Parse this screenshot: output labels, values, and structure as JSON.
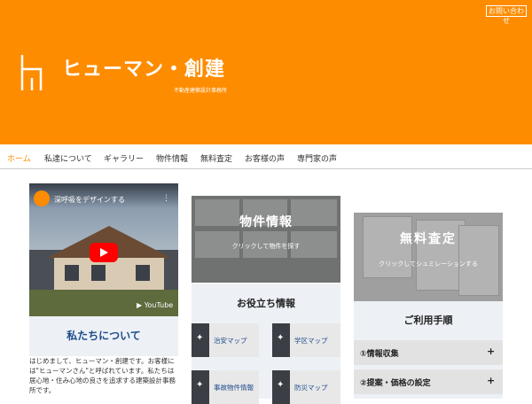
{
  "header": {
    "contact_label": "お問い合わせ",
    "site_title": "ヒューマン・創建",
    "tagline": "不動産建築設計事務所",
    "background": "#fe8c00"
  },
  "nav": {
    "items": [
      {
        "label": "ホーム",
        "active": true
      },
      {
        "label": "私達について"
      },
      {
        "label": "ギャラリー"
      },
      {
        "label": "物件情報"
      },
      {
        "label": "無料査定"
      },
      {
        "label": "お客様の声"
      },
      {
        "label": "専門家の声"
      }
    ]
  },
  "video": {
    "title": "深呼吸をデザインする",
    "menu": "⋮",
    "brand": "▶ YouTube"
  },
  "about": {
    "title": "私たちについて",
    "text": "はじめまして、ヒューマン・創建です。お客様には\"ヒューマンさん\"と呼ばれています。私たちは居心地・住み心地の良さを追求する建築設計事務所です。"
  },
  "property": {
    "title": "物件情報",
    "subtitle": "クリックして物件を探す"
  },
  "useful": {
    "title": "お役立ち情報",
    "items": [
      {
        "label": "治安マップ",
        "icon": "sparkle-icon"
      },
      {
        "label": "学区マップ",
        "icon": "sparkle-icon"
      },
      {
        "label": "事故物件情報",
        "icon": "sparkle-icon"
      },
      {
        "label": "防災マップ",
        "icon": "sparkle-icon"
      }
    ]
  },
  "estimate": {
    "title": "無料査定",
    "subtitle": "クリックしてシュミレーションする"
  },
  "procedure": {
    "title": "ご利用手順",
    "items": [
      {
        "label": "①情報収集",
        "icon": "+"
      },
      {
        "label": "②提案・価格の設定",
        "icon": "+"
      }
    ]
  }
}
